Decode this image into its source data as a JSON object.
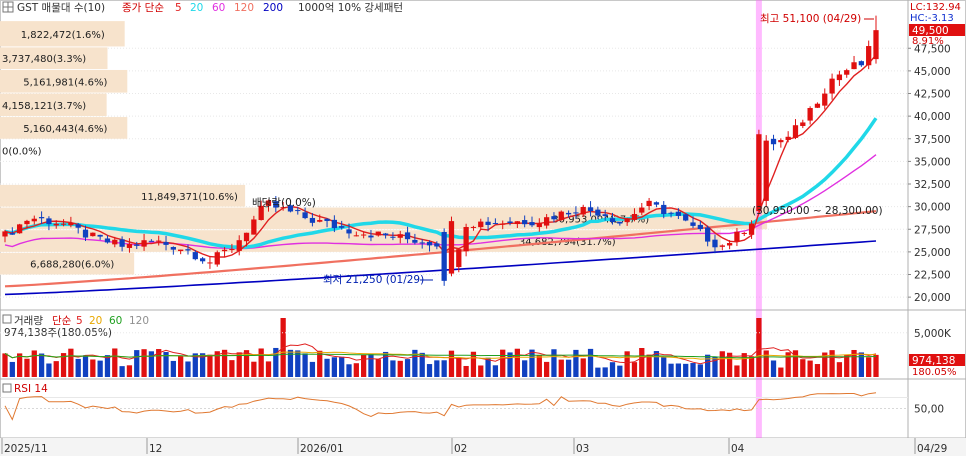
{
  "chart_data": {
    "type": "candlestick",
    "price_panel": {
      "header": {
        "icon": "grid-icon",
        "title": "GST 매물대 수(10)",
        "ma_label": "종가 단순",
        "ma_periods": [
          "5",
          "20",
          "60",
          "120",
          "200"
        ],
        "ma_colors": [
          "#e02020",
          "#20d8e8",
          "#e030e0",
          "#f07060",
          "#0000c0"
        ],
        "box_label": "1000억 10% 강세패턴"
      },
      "y_ticks": [
        "47,500",
        "45,000",
        "42,500",
        "40,000",
        "37,500",
        "35,000",
        "32,500",
        "30,000",
        "27,500",
        "25,000",
        "22,500",
        "20,000"
      ],
      "ylim": [
        18800,
        52500
      ],
      "right_labels": {
        "lc": "LC:132.94",
        "hc": "HC:-3.13",
        "current": "49,500",
        "change": "8.91%"
      },
      "volume_profile": [
        {
          "label": "1,822,472(1.6%)",
          "price_from": 47700,
          "price_to": 50500,
          "strength": 0.145
        },
        {
          "label": "3,737,480(3.3%)",
          "price_from": 45200,
          "price_to": 47600,
          "strength": 0.125
        },
        {
          "label": "5,161,981(4.6%)",
          "price_from": 42600,
          "price_to": 45100,
          "strength": 0.148
        },
        {
          "label": "4,158,121(3.7%)",
          "price_from": 40000,
          "price_to": 42500,
          "strength": 0.124
        },
        {
          "label": "5,160,443(4.6%)",
          "price_from": 37500,
          "price_to": 39900,
          "strength": 0.148
        },
        {
          "label": "0(0.0%)",
          "price_from": 35000,
          "price_to": 37400,
          "strength": 0.0
        },
        {
          "label": "",
          "price_from": 32500,
          "price_to": 34900,
          "strength": 0.0
        },
        {
          "label": "11,849,371(10.6%)",
          "price_from": 30000,
          "price_to": 32400,
          "strength": 0.285
        },
        {
          "label": "30,953,094(27.7%)",
          "price_from": 27500,
          "price_to": 29900,
          "strength": 0.892
        },
        {
          "label": "34,682,794(31.7%)",
          "price_from": 25000,
          "price_to": 27400,
          "strength": 0.838
        },
        {
          "label": "6,688,280(6.0%)",
          "price_from": 22500,
          "price_to": 24900,
          "strength": 0.156
        }
      ],
      "annotations": {
        "high": "최고 51,100 (04/29)",
        "low": "최저 21,250 (01/29)",
        "box_top": "(30,950.00 ~ 28,300.00)",
        "dividend": "배당락(0.0%)"
      }
    },
    "volume_panel": {
      "header": {
        "title": "거래량",
        "ma_label": "단순",
        "ma_periods": [
          "5",
          "20",
          "60",
          "120"
        ],
        "ma_colors": [
          "#e02020",
          "#e8a800",
          "#20a020",
          "#909090"
        ]
      },
      "value_label": "974,138주(180.05%)",
      "y_tick": "5,000K",
      "current": "974,138",
      "change": "180.05%"
    },
    "rsi_panel": {
      "header": "RSI 14",
      "y_tick": "50,00",
      "line_color": "#e07830"
    },
    "x_axis": {
      "ticks": [
        "2025/11",
        "12",
        "2026/01",
        "02",
        "03",
        "04",
        "04/29"
      ]
    },
    "highlight_color": "#ff66ff",
    "up_color": "#e01010",
    "down_color": "#1040c0"
  }
}
